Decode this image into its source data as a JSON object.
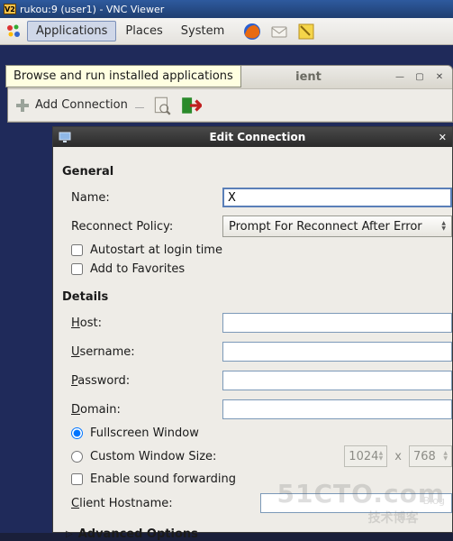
{
  "vnc": {
    "title": "rukou:9 (user1) - VNC Viewer",
    "icon_text": "V2"
  },
  "menubar": {
    "applications": "Applications",
    "places": "Places",
    "system": "System"
  },
  "tooltip": "Browse and run installed applications",
  "client_window": {
    "title_suffix": "ient",
    "add_connection": "Add Connection"
  },
  "dialog": {
    "title": "Edit Connection",
    "general": {
      "heading": "General",
      "name_label": "Name:",
      "name_value": "X",
      "reconnect_label": "Reconnect Policy:",
      "reconnect_value": "Prompt For Reconnect After Error",
      "autostart": "Autostart at login time",
      "favorites": "Add to Favorites"
    },
    "details": {
      "heading": "Details",
      "host_label": "ost:",
      "host_mn": "H",
      "user_label": "sername:",
      "user_mn": "U",
      "pass_label": "assword:",
      "pass_mn": "P",
      "domain_label": "omain:",
      "domain_mn": "D",
      "fullscreen": "Fullscreen Window",
      "custom": "Custom Window Size:",
      "w": "1024",
      "x": "x",
      "h": "768",
      "sound": "Enable sound forwarding",
      "client_host_mn": "C",
      "client_host_label": "lient Hostname:"
    },
    "advanced": "Advanced Options"
  },
  "watermark": {
    "l1": "51CTO.com",
    "l2": "技术博客",
    "blog": "Blog"
  }
}
